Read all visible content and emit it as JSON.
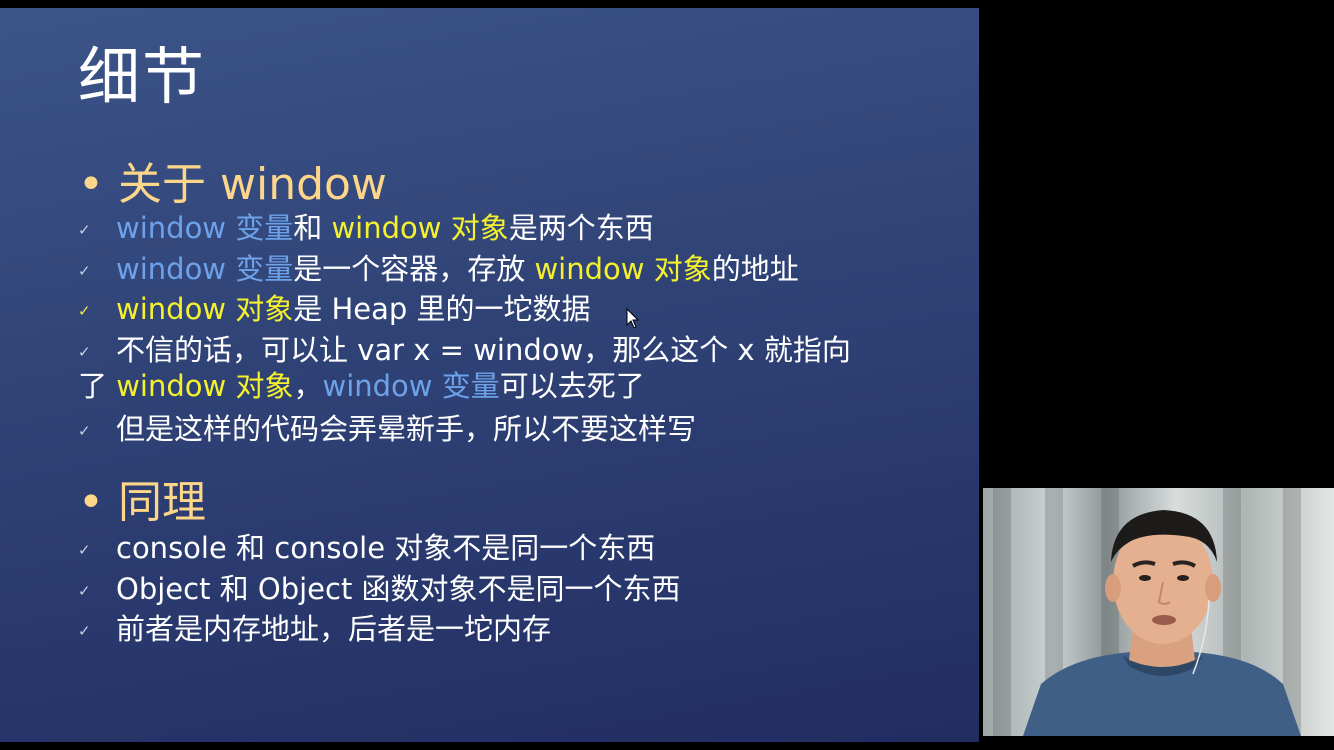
{
  "slide": {
    "title": "细节",
    "section1": {
      "bullet": "•",
      "heading": "关于 window"
    },
    "section1_items": [
      {
        "check": "✓",
        "check_color": "#c8cfdf",
        "parts": [
          {
            "text": "window 变量",
            "color": "#6da2ea"
          },
          {
            "text": "和 ",
            "color": "#ffffff"
          },
          {
            "text": "window 对象",
            "color": "#f5f22d"
          },
          {
            "text": "是两个东西",
            "color": "#ffffff"
          }
        ]
      },
      {
        "check": "✓",
        "check_color": "#c8cfdf",
        "parts": [
          {
            "text": "window 变量",
            "color": "#6da2ea"
          },
          {
            "text": "是一个容器，存放 ",
            "color": "#ffffff"
          },
          {
            "text": "window 对象",
            "color": "#f5f22d"
          },
          {
            "text": "的地址",
            "color": "#ffffff"
          }
        ]
      },
      {
        "check": "✓",
        "check_color": "#f3ef3d",
        "parts": [
          {
            "text": "window 对象",
            "color": "#f5f22d"
          },
          {
            "text": "是 Heap 里的一坨数据",
            "color": "#ffffff"
          }
        ]
      },
      {
        "check": "✓",
        "check_color": "#c8cfdf",
        "line1": "不信的话，可以让 var x = window，那么这个 x 就指向",
        "line2_parts": [
          {
            "text": "了 ",
            "color": "#ffffff"
          },
          {
            "text": "window 对象",
            "color": "#f5f22d"
          },
          {
            "text": "，",
            "color": "#ffffff"
          },
          {
            "text": "window 变量",
            "color": "#6da2ea"
          },
          {
            "text": "可以去死了",
            "color": "#ffffff"
          }
        ]
      },
      {
        "check": "✓",
        "check_color": "#c8cfdf",
        "text": "但是这样的代码会弄晕新手，所以不要这样写"
      }
    ],
    "section2": {
      "bullet": "•",
      "heading": "同理"
    },
    "section2_items": [
      {
        "check": "✓",
        "text": "console 和 console 对象不是同一个东西"
      },
      {
        "check": "✓",
        "text": "Object 和 Object 函数对象不是同一个东西"
      },
      {
        "check": "✓",
        "text": "前者是内存地址，后者是一坨内存"
      }
    ]
  },
  "colors": {
    "heading": "#fdd68a",
    "variable_blue": "#6da2ea",
    "object_yellow": "#f5f22d",
    "body_text": "#ffffff"
  },
  "icons": {
    "pointer": "mouse-pointer-icon",
    "checkmark": "checkmark-icon",
    "bullet": "bullet-dot-icon"
  },
  "webcam": {
    "description_icon": "presenter-webcam-feed"
  }
}
